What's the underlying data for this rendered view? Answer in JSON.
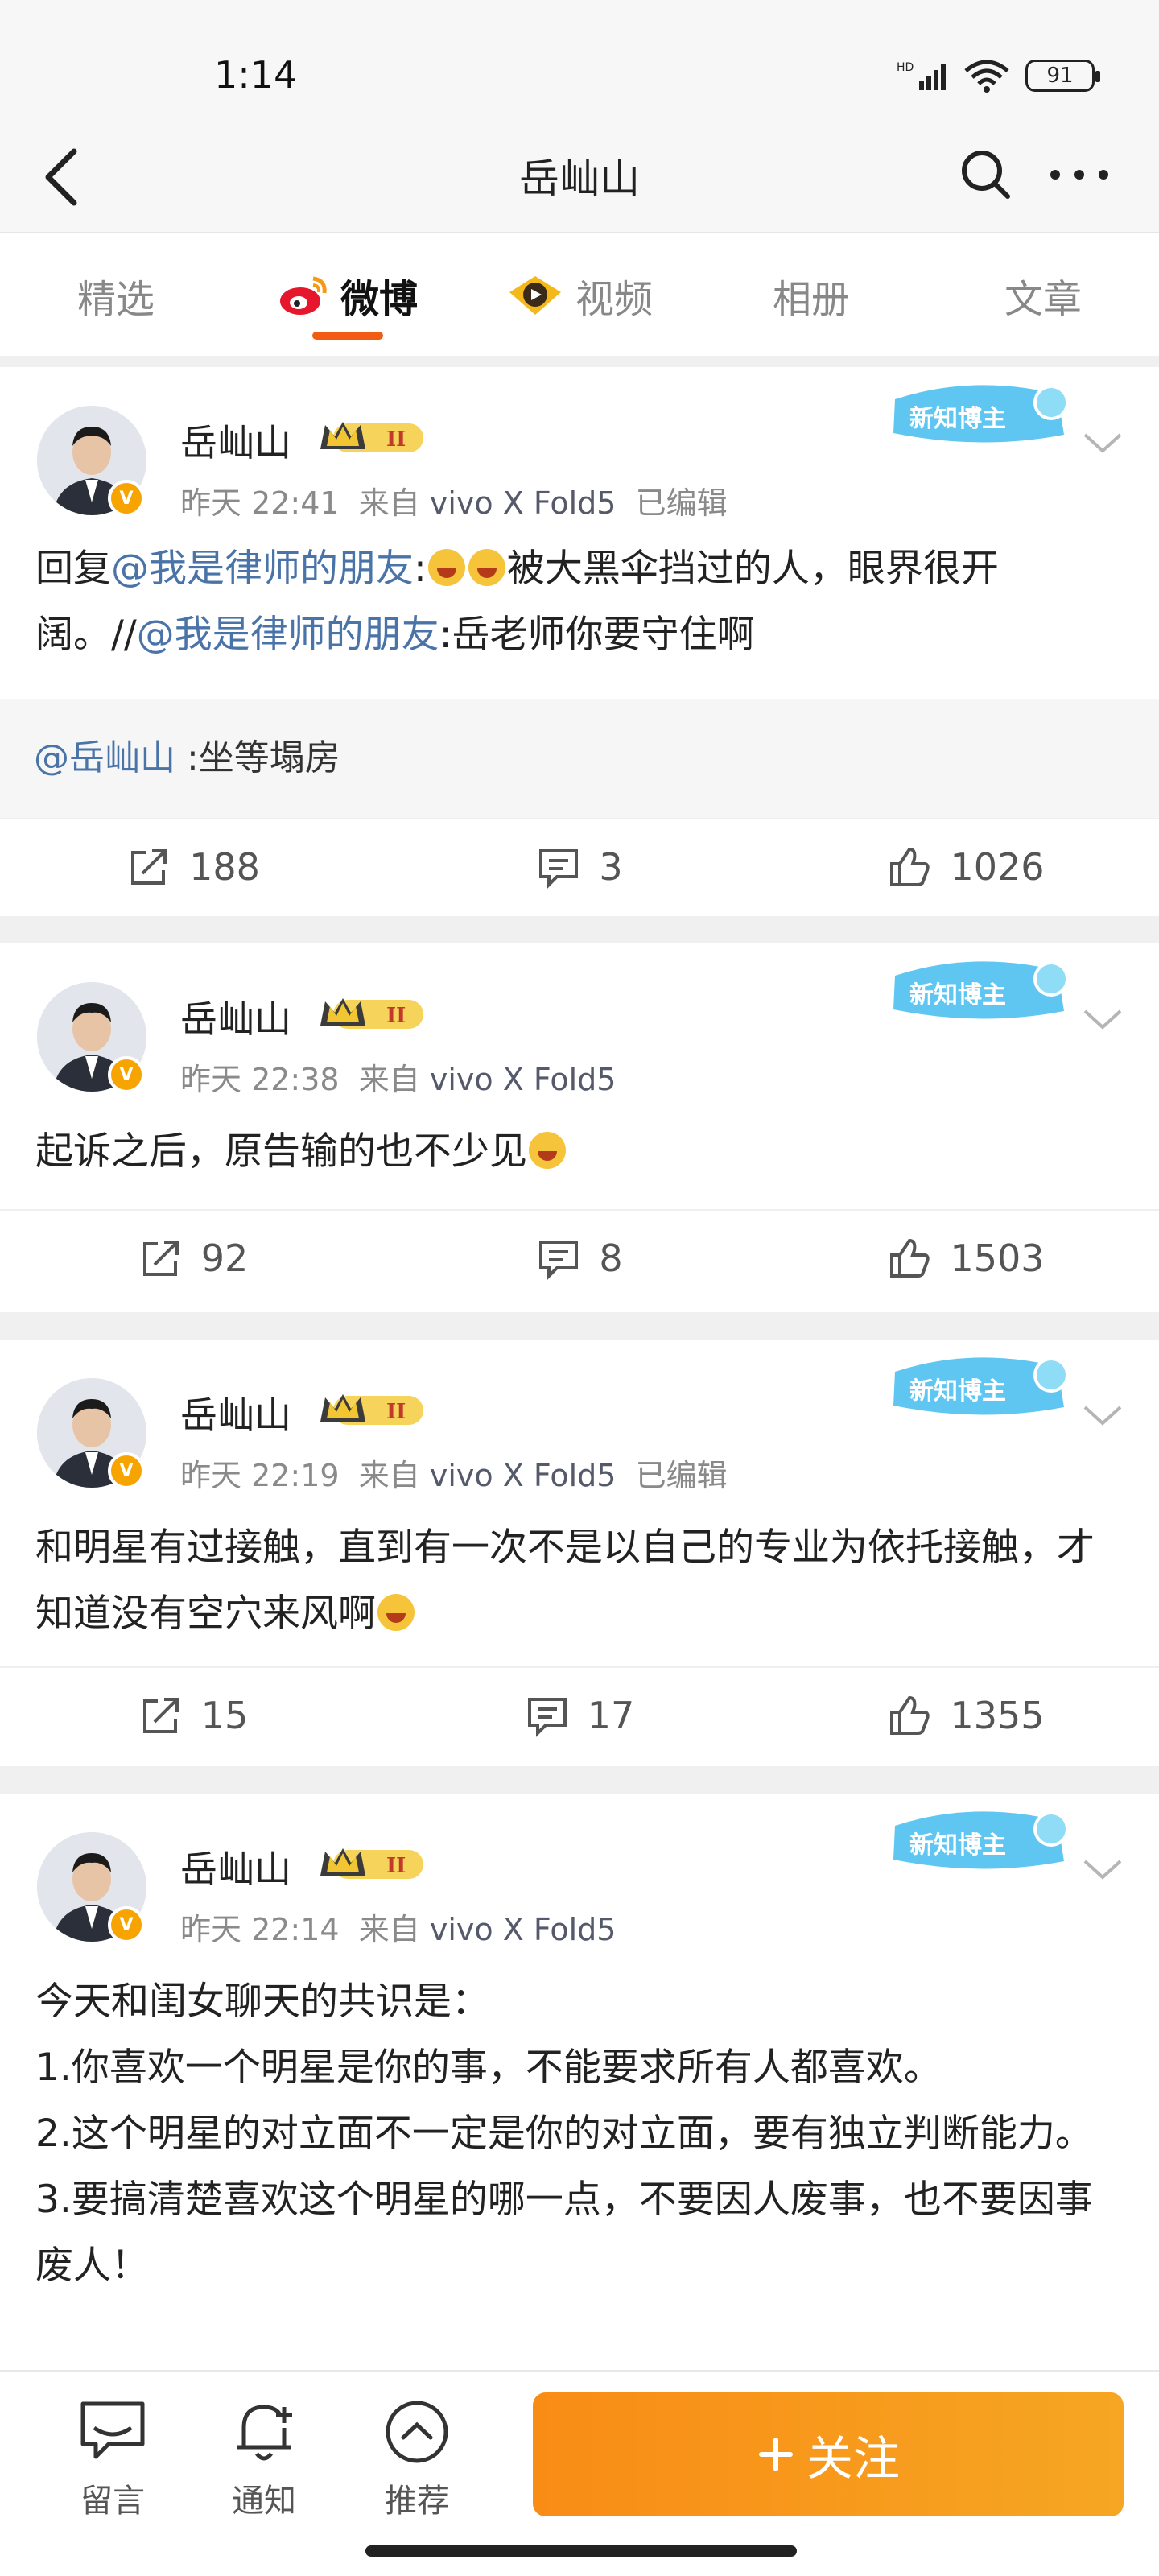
{
  "status_bar": {
    "time": "1:14",
    "battery": "91"
  },
  "header": {
    "title": "岳屾山"
  },
  "tabs": [
    {
      "label": "精选"
    },
    {
      "label": "微博"
    },
    {
      "label": "视频"
    },
    {
      "label": "相册"
    },
    {
      "label": "文章"
    }
  ],
  "badge_text": "新知博主",
  "posts": [
    {
      "author": "岳屾山",
      "time": "昨天 22:41",
      "source_prefix": "来自",
      "source": "vivo X Fold5",
      "edited": "已编辑",
      "content_parts": [
        "回复",
        "@我是律师的朋友",
        ":",
        "被大黑伞挡过的人，眼界很开阔。//",
        "@我是律师的朋友",
        ":岳老师你要守住啊"
      ],
      "quote_mention": "@岳屾山",
      "quote_text": " :坐等塌房",
      "reposts": "188",
      "comments": "3",
      "likes": "1026"
    },
    {
      "author": "岳屾山",
      "time": "昨天 22:38",
      "source_prefix": "来自",
      "source": "vivo X Fold5",
      "content": "起诉之后，原告输的也不少见",
      "reposts": "92",
      "comments": "8",
      "likes": "1503"
    },
    {
      "author": "岳屾山",
      "time": "昨天 22:19",
      "source_prefix": "来自",
      "source": "vivo X Fold5",
      "edited": "已编辑",
      "content": "和明星有过接触，直到有一次不是以自己的专业为依托接触，才知道没有空穴来风啊",
      "reposts": "15",
      "comments": "17",
      "likes": "1355"
    },
    {
      "author": "岳屾山",
      "time": "昨天 22:14",
      "source_prefix": "来自",
      "source": "vivo X Fold5",
      "content_lines": [
        "今天和闺女聊天的共识是：",
        "1.你喜欢一个明星是你的事，不能要求所有人都喜欢。",
        "2.这个明星的对立面不一定是你的对立面，要有独立判断能力。",
        "3.要搞清楚喜欢这个明星的哪一点，不要因人废事，也不要因事废人！"
      ]
    }
  ],
  "bottom_bar": {
    "message": "留言",
    "notify": "通知",
    "recommend": "推荐",
    "follow": "关注"
  }
}
